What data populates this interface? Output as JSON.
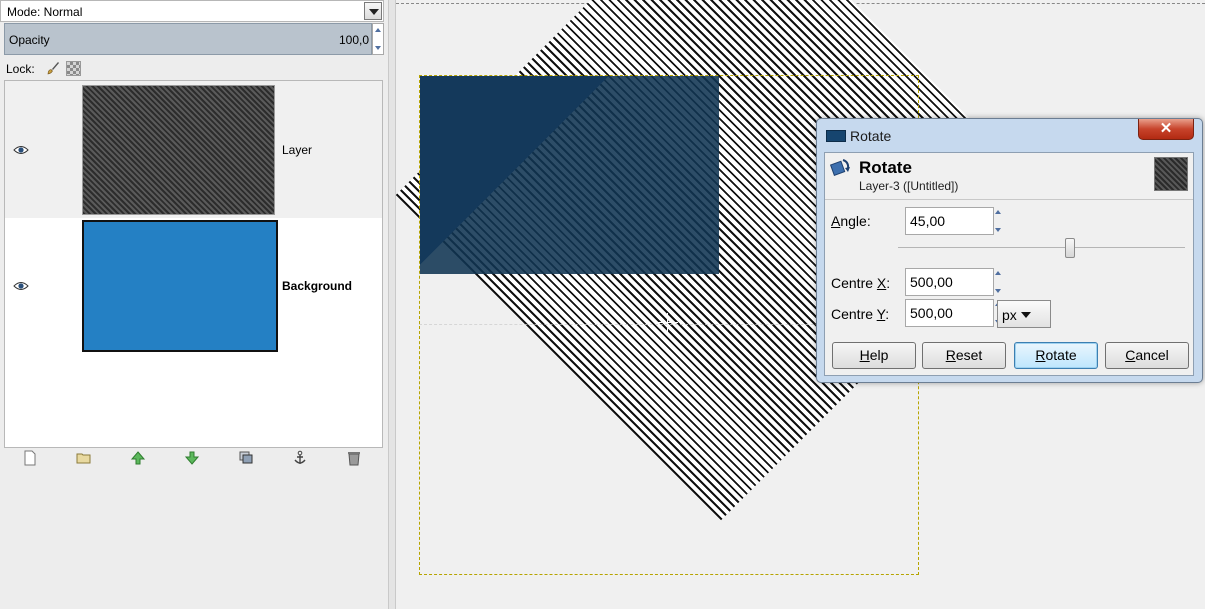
{
  "layers_panel": {
    "mode_label": "Mode: Normal",
    "opacity_label": "Opacity",
    "opacity_value": "100,0",
    "lock_label": "Lock:",
    "layers": [
      {
        "name": "Layer",
        "visible_icon": "eye-icon",
        "bold": false
      },
      {
        "name": "Background",
        "visible_icon": "eye-icon",
        "bold": true
      }
    ],
    "bottom_buttons": [
      "new-layer-icon",
      "open-folder-icon",
      "raise-layer-icon",
      "lower-layer-icon",
      "duplicate-layer-icon",
      "anchor-icon",
      "delete-icon"
    ]
  },
  "rotate_dialog": {
    "window_title": "Rotate",
    "close_label": "✕",
    "header_title": "Rotate",
    "header_subtitle": "Layer-3 ([Untitled])",
    "angle_label_u": "A",
    "angle_label_rest": "ngle:",
    "angle_value": "45,00",
    "angle_slider_fraction": 0.6,
    "centre_x_label_pre": "Centre ",
    "centre_x_label_u": "X",
    "centre_x_label_post": ":",
    "centre_x_value": "500,00",
    "centre_y_label_pre": "Centre ",
    "centre_y_label_u": "Y",
    "centre_y_label_post": ":",
    "centre_y_value": "500,00",
    "unit": "px",
    "buttons": {
      "help_u": "H",
      "help_rest": "elp",
      "reset_u": "R",
      "reset_rest": "eset",
      "rotate_u": "R",
      "rotate_rest": "otate",
      "cancel_u": "C",
      "cancel_rest": "ancel"
    }
  },
  "colors": {
    "background_layer": "#2480c4",
    "dark_rect": "#14395b",
    "selection_bar": "#b9c3cd",
    "dialog_frame": "#c6d9ee"
  }
}
